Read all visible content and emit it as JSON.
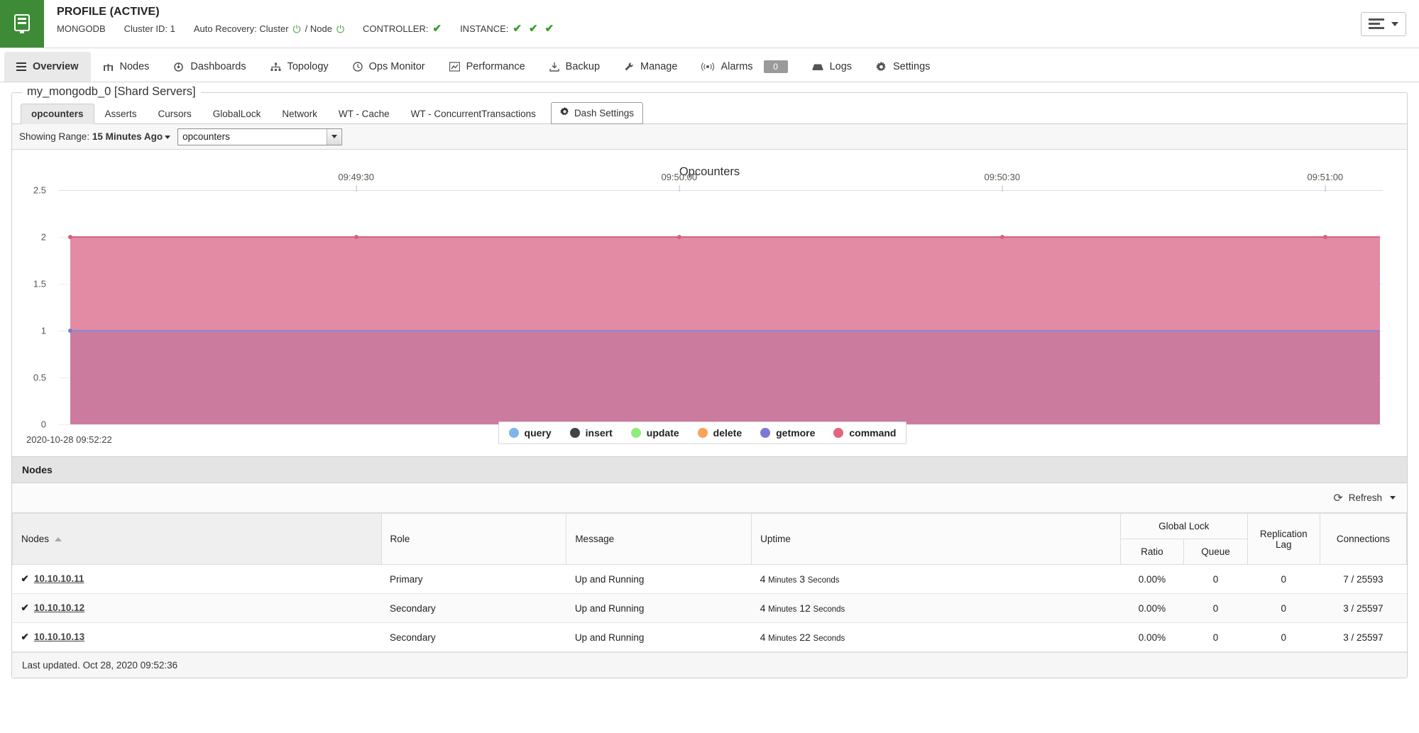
{
  "header": {
    "brand_icon": "database-icon",
    "title": "PROFILE (ACTIVE)",
    "db_type": "MONGODB",
    "cluster_id": "Cluster ID: 1",
    "auto_recovery_label": "Auto Recovery: Cluster",
    "auto_recovery_sep": "/ Node",
    "controller_label": "CONTROLLER:",
    "instance_label": "INSTANCE:",
    "controller_status": "✔",
    "instance_status": [
      "✔",
      "✔",
      "✔"
    ],
    "menu_button": "hamburger-menu"
  },
  "mainnav": {
    "items": [
      {
        "label": "Overview",
        "icon": "list-icon",
        "active": true
      },
      {
        "label": "Nodes",
        "icon": "nodes-icon",
        "active": false
      },
      {
        "label": "Dashboards",
        "icon": "dashboard-icon",
        "active": false
      },
      {
        "label": "Topology",
        "icon": "topology-icon",
        "active": false
      },
      {
        "label": "Ops Monitor",
        "icon": "clock-icon",
        "active": false
      },
      {
        "label": "Performance",
        "icon": "chart-icon",
        "active": false
      },
      {
        "label": "Backup",
        "icon": "backup-icon",
        "active": false
      },
      {
        "label": "Manage",
        "icon": "wrench-icon",
        "active": false
      },
      {
        "label": "Alarms",
        "icon": "signal-icon",
        "active": false,
        "badge": "0"
      },
      {
        "label": "Logs",
        "icon": "logs-icon",
        "active": false
      },
      {
        "label": "Settings",
        "icon": "gear-icon",
        "active": false
      }
    ]
  },
  "panel": {
    "title": "my_mongodb_0 [Shard Servers]"
  },
  "subtabs": {
    "items": [
      {
        "label": "opcounters",
        "active": true
      },
      {
        "label": "Asserts",
        "active": false
      },
      {
        "label": "Cursors",
        "active": false
      },
      {
        "label": "GlobalLock",
        "active": false
      },
      {
        "label": "Network",
        "active": false
      },
      {
        "label": "WT - Cache",
        "active": false
      },
      {
        "label": "WT - ConcurrentTransactions",
        "active": false
      }
    ],
    "dash_settings": "Dash Settings",
    "dash_settings_icon": "gear-icon"
  },
  "rangebar": {
    "prefix": "Showing Range:",
    "range_value": "15 Minutes Ago",
    "select_value": "opcounters"
  },
  "chart_data": {
    "type": "area",
    "title": "Opcounters",
    "xlabel": "",
    "ylabel": "",
    "ylim": [
      0,
      2.5
    ],
    "yticks": [
      0,
      0.5,
      1,
      1.5,
      2,
      2.5
    ],
    "ytick_labels": [
      "0",
      "0.5",
      "1",
      "1.5",
      "2",
      "2.5"
    ],
    "grid": true,
    "legend_position": "bottom",
    "x": [
      "09:49:30",
      "09:50:00",
      "09:50:30",
      "09:51:00"
    ],
    "xtick_labels": [
      "09:49:30",
      "09:50:00",
      "09:50:30",
      "09:51:00"
    ],
    "series": [
      {
        "name": "query",
        "color": "#7cb5ec",
        "values": [
          0,
          0,
          0,
          0
        ]
      },
      {
        "name": "insert",
        "color": "#434348",
        "values": [
          0,
          0,
          0,
          0
        ]
      },
      {
        "name": "update",
        "color": "#90ed7d",
        "values": [
          0,
          0,
          0,
          0
        ]
      },
      {
        "name": "delete",
        "color": "#f7a35c",
        "values": [
          0,
          0,
          0,
          0
        ]
      },
      {
        "name": "getmore",
        "color": "#7d79d2",
        "values": [
          1,
          1,
          1,
          1
        ]
      },
      {
        "name": "command",
        "color": "#e4647f",
        "values": [
          1,
          1,
          1,
          1
        ]
      }
    ],
    "stacked": true,
    "stack_top": 2,
    "timestamp": "2020-10-28 09:52:22"
  },
  "nodes": {
    "section_title": "Nodes",
    "refresh_label": "Refresh",
    "refresh_icon": "refresh-icon",
    "columns": {
      "nodes": "Nodes",
      "role": "Role",
      "message": "Message",
      "uptime": "Uptime",
      "global_lock": "Global Lock",
      "ratio": "Ratio",
      "queue": "Queue",
      "replication_lag": "Replication Lag",
      "connections": "Connections"
    },
    "rows": [
      {
        "status": "✔",
        "node": "10.10.10.11",
        "role": "Primary",
        "message": "Up and Running",
        "uptime_num1": "4",
        "uptime_u1": "Minutes",
        "uptime_num2": "3",
        "uptime_u2": "Seconds",
        "ratio": "0.00%",
        "queue": "0",
        "lag": "0",
        "connections": "7 / 25593"
      },
      {
        "status": "✔",
        "node": "10.10.10.12",
        "role": "Secondary",
        "message": "Up and Running",
        "uptime_num1": "4",
        "uptime_u1": "Minutes",
        "uptime_num2": "12",
        "uptime_u2": "Seconds",
        "ratio": "0.00%",
        "queue": "0",
        "lag": "0",
        "connections": "3 / 25597"
      },
      {
        "status": "✔",
        "node": "10.10.10.13",
        "role": "Secondary",
        "message": "Up and Running",
        "uptime_num1": "4",
        "uptime_u1": "Minutes",
        "uptime_num2": "22",
        "uptime_u2": "Seconds",
        "ratio": "0.00%",
        "queue": "0",
        "lag": "0",
        "connections": "3 / 25597"
      }
    ],
    "last_updated": "Last updated. Oct 28, 2020 09:52:36"
  },
  "colors": {
    "brand_green": "#3d8b37",
    "status_green": "#2e9e2a",
    "command_pink": "#cb7c9e",
    "getmore_purple": "#7d79d2"
  }
}
